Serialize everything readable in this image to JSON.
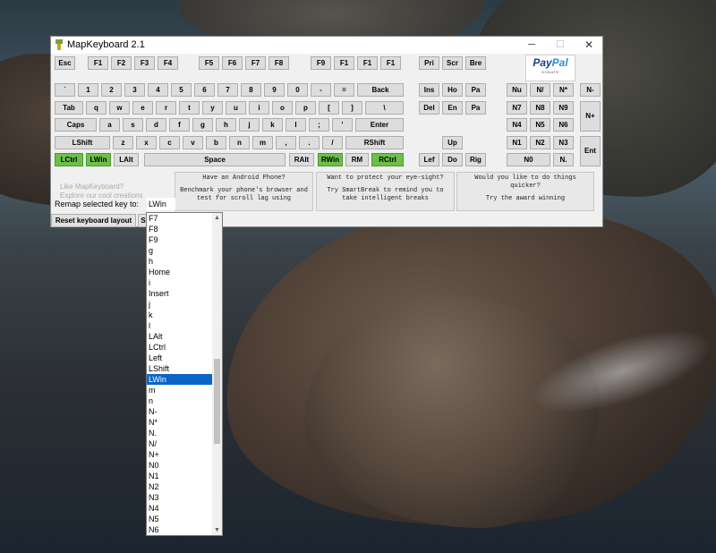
{
  "window": {
    "title": "MapKeyboard 2.1",
    "min_glyph": "─",
    "max_glyph": "☐",
    "close_glyph": "✕"
  },
  "keys": {
    "fn": [
      "Esc",
      "F1",
      "F2",
      "F3",
      "F4",
      "F5",
      "F6",
      "F7",
      "F8",
      "F9",
      "F1",
      "F1",
      "F1"
    ],
    "nav_top": [
      "Pri",
      "Scr",
      "Bre"
    ],
    "row1": [
      "`",
      "1",
      "2",
      "3",
      "4",
      "5",
      "6",
      "7",
      "8",
      "9",
      "0",
      "-",
      "=",
      "Back"
    ],
    "nav1": [
      "Ins",
      "Ho",
      "Pa"
    ],
    "num1": [
      "Nu",
      "N/",
      "N*",
      "N-"
    ],
    "row2": [
      "Tab",
      "q",
      "w",
      "e",
      "r",
      "t",
      "y",
      "u",
      "i",
      "o",
      "p",
      "[",
      "]",
      "\\"
    ],
    "nav2": [
      "Del",
      "En",
      "Pa"
    ],
    "num2": [
      "N7",
      "N8",
      "N9",
      "N+"
    ],
    "row3": [
      "Caps",
      "a",
      "s",
      "d",
      "f",
      "g",
      "h",
      "j",
      "k",
      "l",
      ";",
      "'",
      "Enter"
    ],
    "num3": [
      "N4",
      "N5",
      "N6"
    ],
    "row4": [
      "LShift",
      "z",
      "x",
      "c",
      "v",
      "b",
      "n",
      "m",
      ",",
      ".",
      "/",
      "RShift"
    ],
    "nav4": [
      "Up"
    ],
    "num4": [
      "N1",
      "N2",
      "N3",
      "Ent"
    ],
    "row5": [
      "LCtrl",
      "LWin",
      "LAlt",
      "Space",
      "RAlt",
      "RWin",
      "RM",
      "RCtrl"
    ],
    "nav5": [
      "Lef",
      "Do",
      "Rig"
    ],
    "num5": [
      "N0",
      "N."
    ]
  },
  "paypal": {
    "logo_pay": "Pay",
    "logo_pal": "Pal",
    "sub": "DONATE"
  },
  "ads": [
    {
      "line1": "Have an Android Phone?",
      "line2": "Benchmark your phone's browser and",
      "line3": "test for scroll lag using"
    },
    {
      "line1": "Want to protect your eye-sight?",
      "line2": "Try SmartBreak to remind you to",
      "line3": "take intelligent breaks"
    },
    {
      "line1": "Would you like to do things",
      "line2": "quicker?",
      "line3": "Try the award winning"
    }
  ],
  "promo": {
    "line1": "Like MapKeyboard?",
    "line2": "Explore our cool creations"
  },
  "remap": {
    "label": "Remap selected key to:",
    "value": "LWin"
  },
  "reset_label": "Reset keyboard layout",
  "save_label": "S",
  "dropdown": {
    "items": [
      "F7",
      "F8",
      "F9",
      "g",
      "h",
      "Home",
      "i",
      "Insert",
      "j",
      "k",
      "l",
      "LAlt",
      "LCtrl",
      "Left",
      "LShift",
      "LWin",
      "m",
      "n",
      "N-",
      "N*",
      "N.",
      "N/",
      "N+",
      "N0",
      "N1",
      "N2",
      "N3",
      "N4",
      "N5",
      "N6"
    ],
    "selected": "LWin",
    "up_glyph": "▲",
    "down_glyph": "▼"
  }
}
